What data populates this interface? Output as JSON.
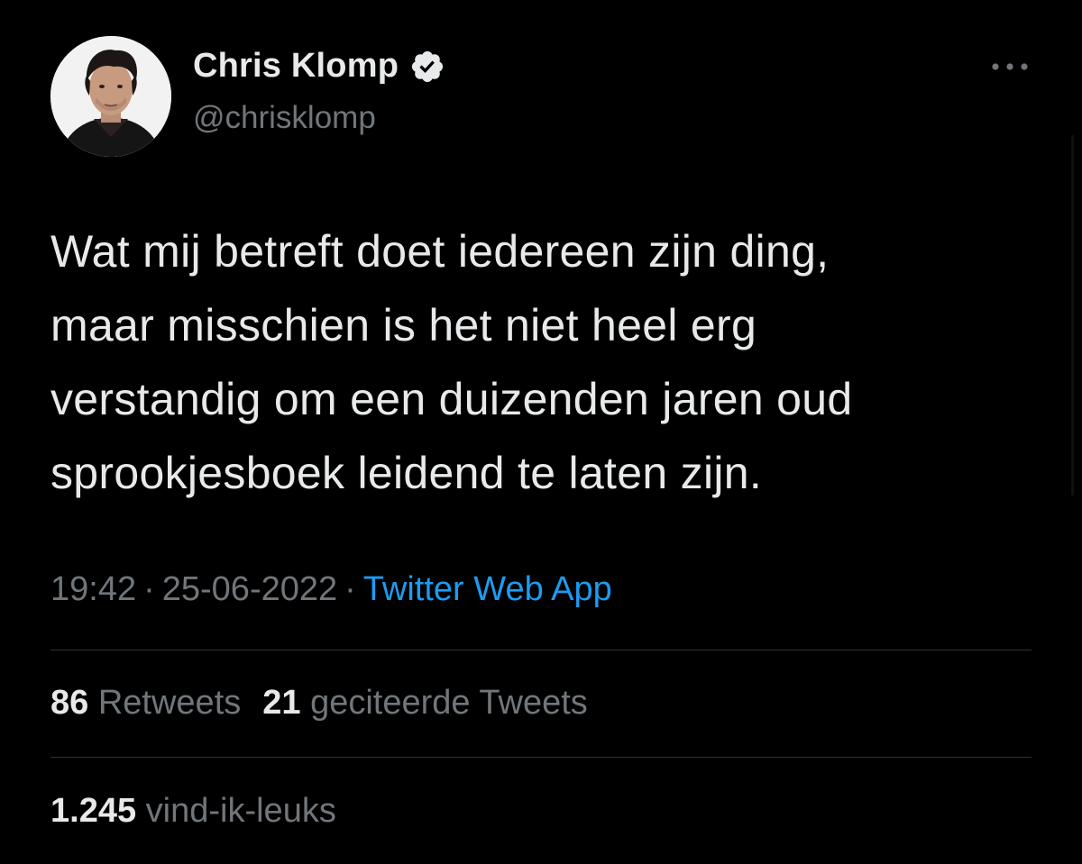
{
  "author": {
    "display_name": "Chris Klomp",
    "handle": "@chrisklomp",
    "verified": true,
    "avatar_icon": "profile-photo"
  },
  "tweet": {
    "lines": [
      "Wat mij betreft doet iedereen zijn ding,",
      "maar misschien is het niet heel erg",
      "verstandig om een duizenden jaren oud",
      "sprookjesboek leidend te laten zijn."
    ]
  },
  "meta": {
    "time": "19:42",
    "separator": "·",
    "date": "25-06-2022",
    "source": "Twitter Web App"
  },
  "stats": {
    "retweets_count": "86",
    "retweets_label": "Retweets",
    "quotes_count": "21",
    "quotes_label": "geciteerde Tweets",
    "likes_count": "1.245",
    "likes_label": "vind-ik-leuks"
  },
  "icons": {
    "more": "more-horizontal-icon",
    "verified": "verified-badge-icon"
  },
  "colors": {
    "background": "#000000",
    "primary_text": "#e7e9ea",
    "secondary_text": "#71767b",
    "link": "#1d9bf0",
    "divider": "#2f3336"
  }
}
